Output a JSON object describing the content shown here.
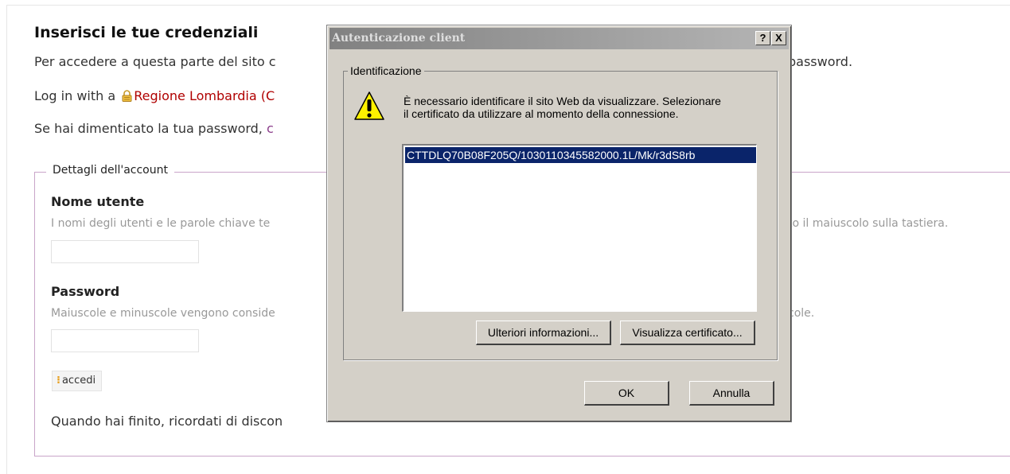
{
  "page": {
    "title": "Inserisci le tue credenziali",
    "intro_start": "Per accedere a questa parte del sito c",
    "intro_end": "password.",
    "login_prefix": "Log in with a ",
    "login_link": "Regione Lombardia (C",
    "forgot_prefix": "Se hai dimenticato la tua password, ",
    "forgot_link": "c",
    "fieldset_legend": "Dettagli dell'account",
    "username_label": "Nome utente",
    "username_help": "I nomi degli utenti e le parole chiave te",
    "username_help_tail": "to il maiuscolo sulla tastiera.",
    "password_label": "Password",
    "password_help": "Maiuscole e minuscole vengono conside",
    "password_help_tail": "cole.",
    "login_button": "accedi",
    "finish_text": "Quando hai finito, ricordati di discon"
  },
  "dialog": {
    "title": "Autenticazione client",
    "help_button": "?",
    "close_button": "X",
    "group_label": "Identificazione",
    "message": "È necessario identificare il sito Web da visualizzare. Selezionare il certificato da utilizzare al momento della connessione.",
    "certificates": [
      "CTTDLQ70B08F205Q/1030110345582000.1L/Mk/r3dS8rb"
    ],
    "more_info_button": "Ulteriori informazioni...",
    "view_cert_button": "Visualizza certificato...",
    "ok_button": "OK",
    "cancel_button": "Annulla"
  },
  "colors": {
    "link_red": "#b00000",
    "link_purple": "#8a3c8a",
    "fieldset_border": "#c9a4c9",
    "selection": "#0a246a",
    "dialog_face": "#d4d0c8"
  },
  "icons": [
    "lock-icon",
    "warning-icon",
    "button-bullet-icon"
  ]
}
